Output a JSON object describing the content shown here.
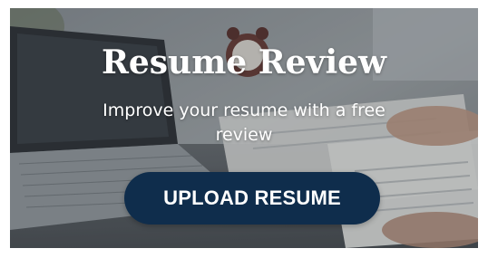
{
  "banner": {
    "title": "Resume Review",
    "subtitle": "Improve your resume with a free review",
    "cta_label": "UPLOAD RESUME"
  },
  "colors": {
    "button_bg": "#0f2d4c",
    "text": "#ffffff"
  }
}
